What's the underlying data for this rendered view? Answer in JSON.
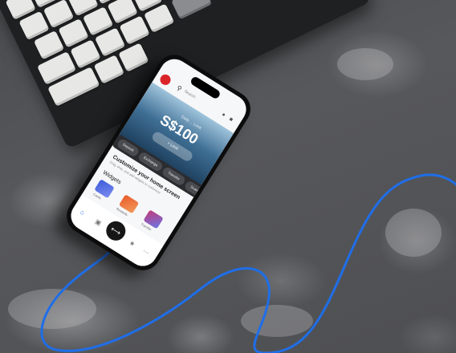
{
  "phone": {
    "search_text": "Search",
    "hero": {
      "label": "Daily ... Limit",
      "amount": "S$100",
      "button": "+ Limit"
    },
    "quick_actions": [
      "Deposit",
      "Exchange",
      "Transfer",
      "Scan"
    ],
    "customize_title": "Customize your home screen",
    "customize_subtitle": "Drag, drop, and add widgets to customize",
    "widgets_label": "Widgets",
    "widget_tiles": [
      "Cards",
      "Rewards",
      "Transfer"
    ],
    "tabs": [
      "home",
      "cards",
      "scan",
      "rewards",
      "more"
    ]
  },
  "colors": {
    "brand_red": "#d9242a",
    "cable_blue": "#1f6ee8",
    "hero_dark": "#1b3b58"
  }
}
